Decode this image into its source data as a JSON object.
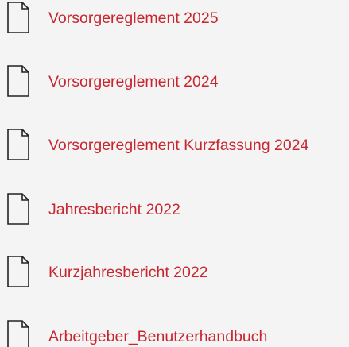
{
  "colors": {
    "background": "#f4f4f4",
    "link": "#c8262f",
    "icon_stroke": "#222222"
  },
  "documents": [
    {
      "label": "Vorsorgereglement 2025",
      "icon": "document-icon"
    },
    {
      "label": "Vorsorgereglement 2024",
      "icon": "document-icon"
    },
    {
      "label": "Vorsorgereglement Kurzfassung 2024",
      "icon": "document-icon"
    },
    {
      "label": "Jahresbericht 2022",
      "icon": "document-icon"
    },
    {
      "label": "Kurzjahresbericht 2022",
      "icon": "document-icon"
    },
    {
      "label": "Arbeitgeber_Benutzerhandbuch",
      "icon": "document-icon"
    }
  ]
}
